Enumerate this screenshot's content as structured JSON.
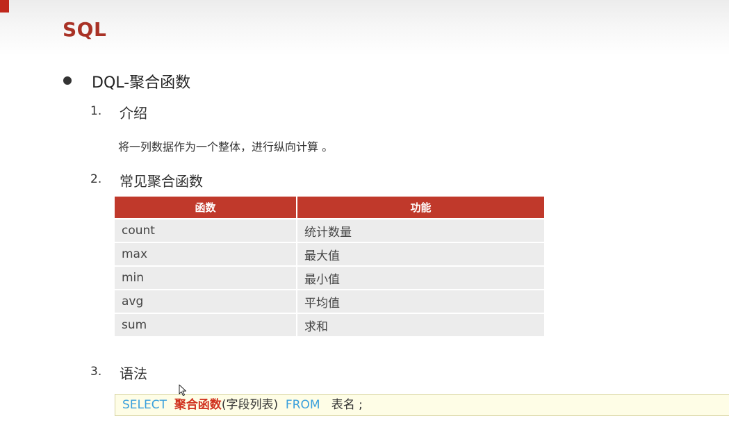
{
  "slide": {
    "title": "SQL",
    "heading": "DQL-聚合函数"
  },
  "sections": [
    {
      "number": "1.",
      "label": "介绍"
    },
    {
      "number": "2.",
      "label": "常见聚合函数"
    },
    {
      "number": "3.",
      "label": "语法"
    }
  ],
  "intro": {
    "description": "将一列数据作为一个整体，进行纵向计算 。"
  },
  "table": {
    "headers": [
      "函数",
      "功能"
    ],
    "rows": [
      [
        "count",
        "统计数量"
      ],
      [
        "max",
        "最大值"
      ],
      [
        "min",
        "最小值"
      ],
      [
        "avg",
        "平均值"
      ],
      [
        "sum",
        "求和"
      ]
    ]
  },
  "syntax": {
    "select_kw": "SELECT",
    "func": "聚合函数",
    "args": "(字段列表)",
    "from_kw": "FROM",
    "table_name": "表名 ;"
  },
  "colors": {
    "title": "#a93226",
    "table_header": "#c0392b",
    "keyword": "#3aa0dc",
    "function": "#d0311e",
    "code_background": "#fefde6"
  },
  "icons": {
    "pointer": "mouse-cursor-icon",
    "bullet": "bullet-dot-icon"
  }
}
